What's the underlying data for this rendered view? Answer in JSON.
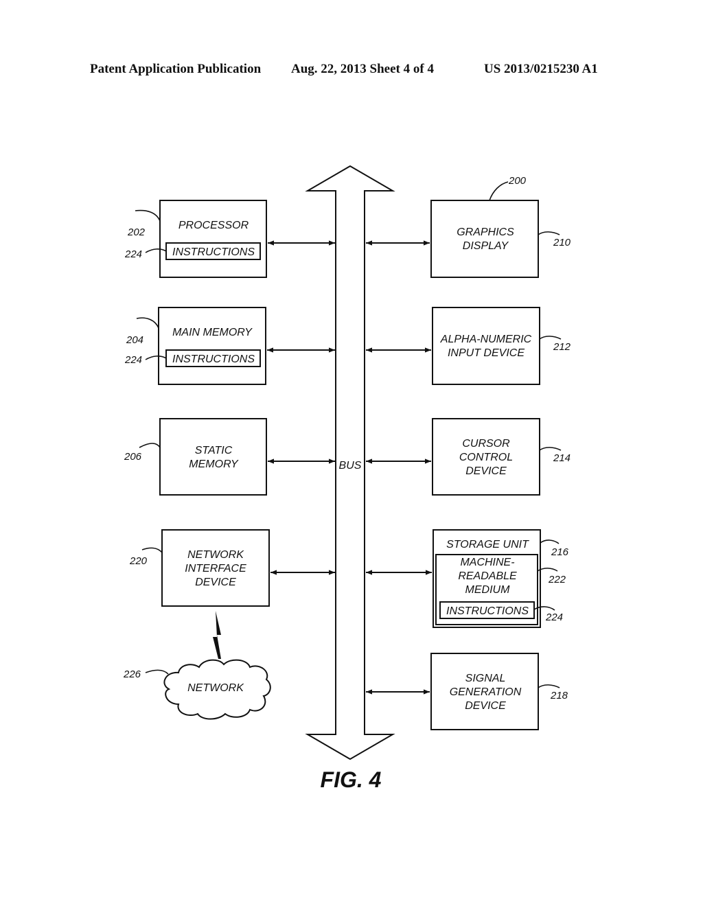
{
  "header": {
    "publication": "Patent Application Publication",
    "date_sheet": "Aug. 22, 2013  Sheet 4 of 4",
    "number": "US 2013/0215230 A1"
  },
  "diagram": {
    "system_ref": "200",
    "bus_label": "BUS",
    "figure_label": "FIG. 4",
    "left": [
      {
        "id": "processor",
        "lines": [
          "PROCESSOR"
        ],
        "ref": "202",
        "inner": {
          "label": "INSTRUCTIONS",
          "ref": "224"
        }
      },
      {
        "id": "main-memory",
        "lines": [
          "MAIN MEMORY"
        ],
        "ref": "204",
        "inner": {
          "label": "INSTRUCTIONS",
          "ref": "224"
        }
      },
      {
        "id": "static-memory",
        "lines": [
          "STATIC",
          "MEMORY"
        ],
        "ref": "206"
      },
      {
        "id": "network-interface-device",
        "lines": [
          "NETWORK",
          "INTERFACE",
          "DEVICE"
        ],
        "ref": "220"
      }
    ],
    "right": [
      {
        "id": "graphics-display",
        "lines": [
          "GRAPHICS",
          "DISPLAY"
        ],
        "ref": "210"
      },
      {
        "id": "alpha-numeric-input-device",
        "lines": [
          "ALPHA-NUMERIC",
          "INPUT DEVICE"
        ],
        "ref": "212"
      },
      {
        "id": "cursor-control-device",
        "lines": [
          "CURSOR",
          "CONTROL",
          "DEVICE"
        ],
        "ref": "214"
      },
      {
        "id": "storage-unit",
        "lines": [
          "STORAGE UNIT"
        ],
        "ref": "216",
        "medium": {
          "lines": [
            "MACHINE-",
            "READABLE",
            "MEDIUM"
          ],
          "ref": "222"
        },
        "inner": {
          "label": "INSTRUCTIONS",
          "ref": "224"
        }
      },
      {
        "id": "signal-generation-device",
        "lines": [
          "SIGNAL",
          "GENERATION",
          "DEVICE"
        ],
        "ref": "218"
      }
    ],
    "network": {
      "label": "NETWORK",
      "ref": "226"
    }
  }
}
